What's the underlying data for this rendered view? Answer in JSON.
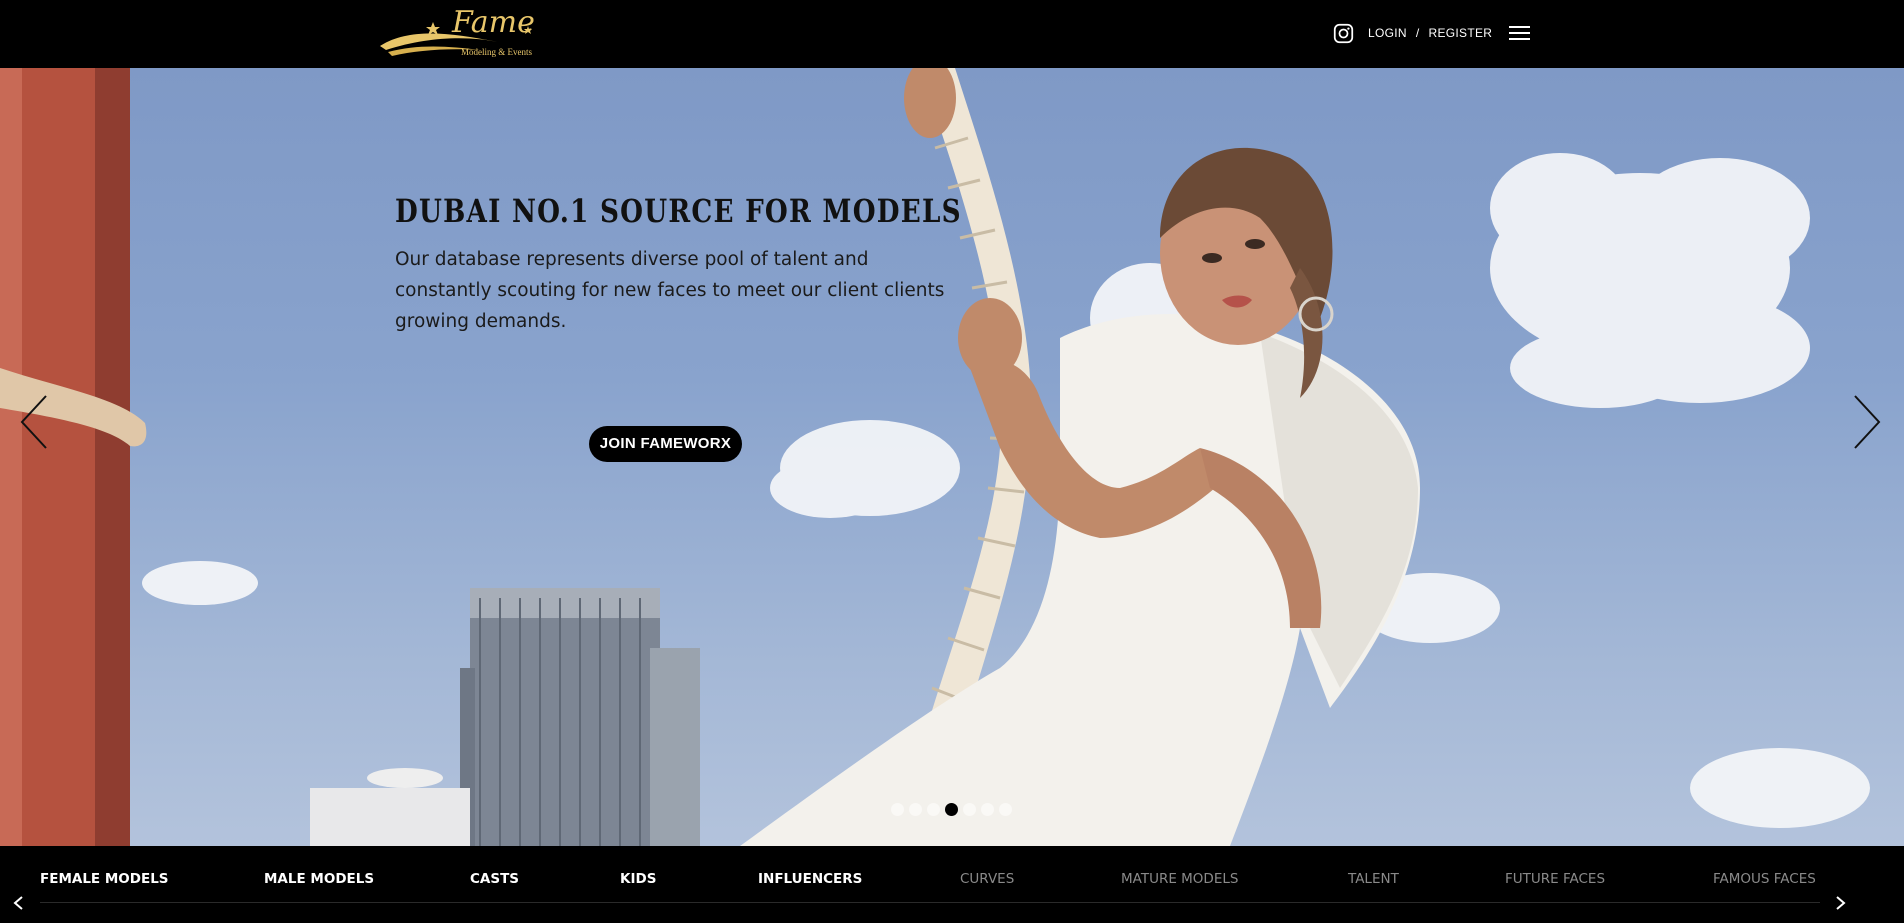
{
  "header": {
    "logo_text": "Fame",
    "logo_tagline": "Modeling & Events",
    "login_label": "LOGIN",
    "separator": "/",
    "register_label": "REGISTER"
  },
  "hero": {
    "title": "DUBAI NO.1 SOURCE FOR MODELS",
    "description": "Our database represents diverse pool of talent and constantly scouting for new faces to meet our client clients growing demands.",
    "cta_label": "JOIN FAMEWORX",
    "slides_count": 7,
    "active_slide": 4
  },
  "categories": [
    {
      "label": "FEMALE MODELS"
    },
    {
      "label": "MALE MODELS"
    },
    {
      "label": "CASTS"
    },
    {
      "label": "KIDS"
    },
    {
      "label": "INFLUENCERS"
    },
    {
      "label": "CURVES"
    },
    {
      "label": "MATURE MODELS"
    },
    {
      "label": "TALENT"
    },
    {
      "label": "FUTURE FACES"
    },
    {
      "label": "FAMOUS FACES"
    }
  ],
  "colors": {
    "header_bg": "#000000",
    "accent_gold": "#e8c66a",
    "sky": "#8aa4cd"
  }
}
